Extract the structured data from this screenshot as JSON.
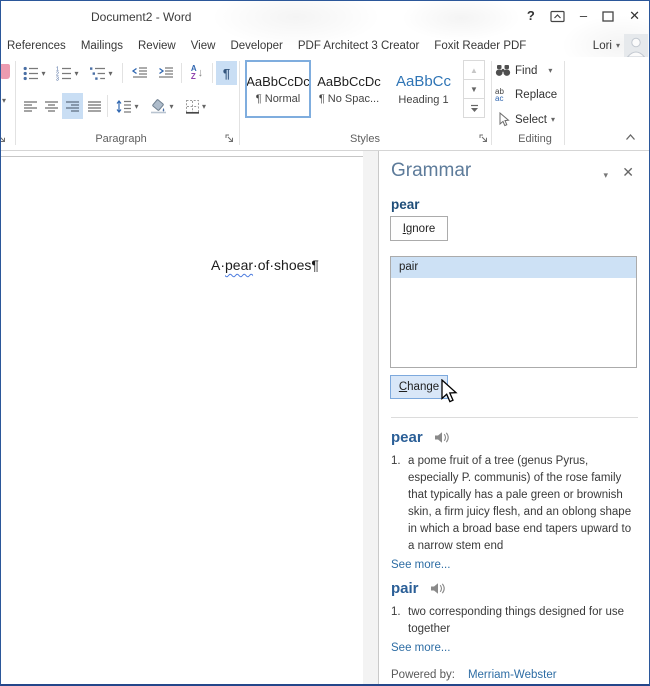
{
  "window": {
    "title": "Document2 - Word",
    "controls": {
      "help": "?",
      "minimize": "–",
      "close": "✕"
    }
  },
  "ribbon": {
    "tabs": [
      {
        "label": "References"
      },
      {
        "label": "Mailings"
      },
      {
        "label": "Review"
      },
      {
        "label": "View"
      },
      {
        "label": "Developer"
      },
      {
        "label": "PDF Architect 3 Creator"
      },
      {
        "label": "Foxit Reader PDF"
      }
    ],
    "user": {
      "name": "Lori"
    },
    "groups": {
      "paragraph": {
        "label": "Paragraph"
      },
      "styles": {
        "label": "Styles",
        "items": [
          {
            "preview": "AaBbCcDc",
            "name": "¶ Normal"
          },
          {
            "preview": "AaBbCcDc",
            "name": "¶ No Spac..."
          },
          {
            "preview": "AaBbCc",
            "name": "Heading 1"
          }
        ]
      },
      "editing": {
        "label": "Editing",
        "items": [
          {
            "label": "Find"
          },
          {
            "label": "Replace"
          },
          {
            "label": "Select"
          }
        ]
      }
    },
    "icons": {
      "dropdown": "▾",
      "pilcrow": "¶",
      "sort_a": "A",
      "sort_z": "Z",
      "sort_arrow": "↓",
      "num1": "1",
      "num2": "2",
      "num3": "3",
      "replace_top": "ab",
      "replace_bottom": "ac"
    }
  },
  "document": {
    "text_before": "A·",
    "flagged_word": "pear",
    "text_after": "·of·shoes¶"
  },
  "grammar_pane": {
    "title": "Grammar",
    "word": "pear",
    "ignore_button": {
      "accel": "I",
      "rest": "gnore"
    },
    "suggestions": [
      "pair"
    ],
    "change_button": {
      "accel": "C",
      "rest": "hange"
    },
    "definitions": [
      {
        "word": "pear",
        "num": "1.",
        "body": "a pome fruit of a tree (genus Pyrus, especially P. communis) of the rose family that typically has a pale green or brownish skin, a firm juicy flesh, and an oblong shape in which a broad base end tapers upward to a narrow stem end",
        "see_more": "See more..."
      },
      {
        "word": "pair",
        "num": "1.",
        "body": "two corresponding things designed for use together",
        "see_more": "See more..."
      }
    ],
    "powered_by_label": "Powered by:",
    "powered_by_link": "Merriam-Webster"
  },
  "colors": {
    "window_border": "#2b579a",
    "ribbon_active_bg": "#c9def4",
    "style_selected_border": "#7fadde",
    "grammar_title": "#5d7b9a",
    "word_heading": "#1f4e79",
    "definition_heading": "#2b5f97",
    "link": "#2e6da4",
    "suggestion_selected_bg": "#cde1f5",
    "change_button_bg": "#d9e7f8",
    "change_button_border": "#7da9dd",
    "squiggle": "#4a7ade",
    "heading1_preview": "#2e74b5"
  }
}
